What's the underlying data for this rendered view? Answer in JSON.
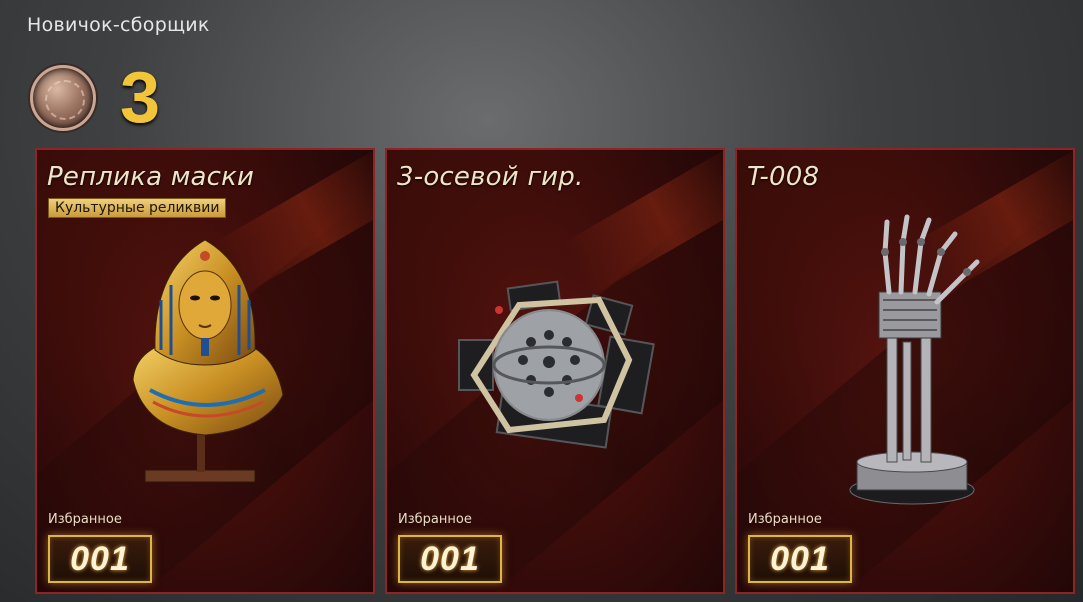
{
  "header": {
    "title": "Новичок-сборщик",
    "level_value": "3",
    "level_emblem_icon": "collector-rank-emblem-icon"
  },
  "accent_color": "#f2c43a",
  "card_border_color": "#8e2424",
  "cards": [
    {
      "title": "Реплика маски",
      "badge": "Культурные реликвии",
      "art_icon": "pharaoh-mask-bust-icon",
      "fav_label": "Избранное",
      "counter": "001"
    },
    {
      "title": "3-осевой гир.",
      "art_icon": "three-axis-gyroscope-icon",
      "fav_label": "Избранное",
      "counter": "001"
    },
    {
      "title": "T-008",
      "art_icon": "robot-arm-endoskeleton-icon",
      "fav_label": "Избранное",
      "counter": "001"
    }
  ]
}
